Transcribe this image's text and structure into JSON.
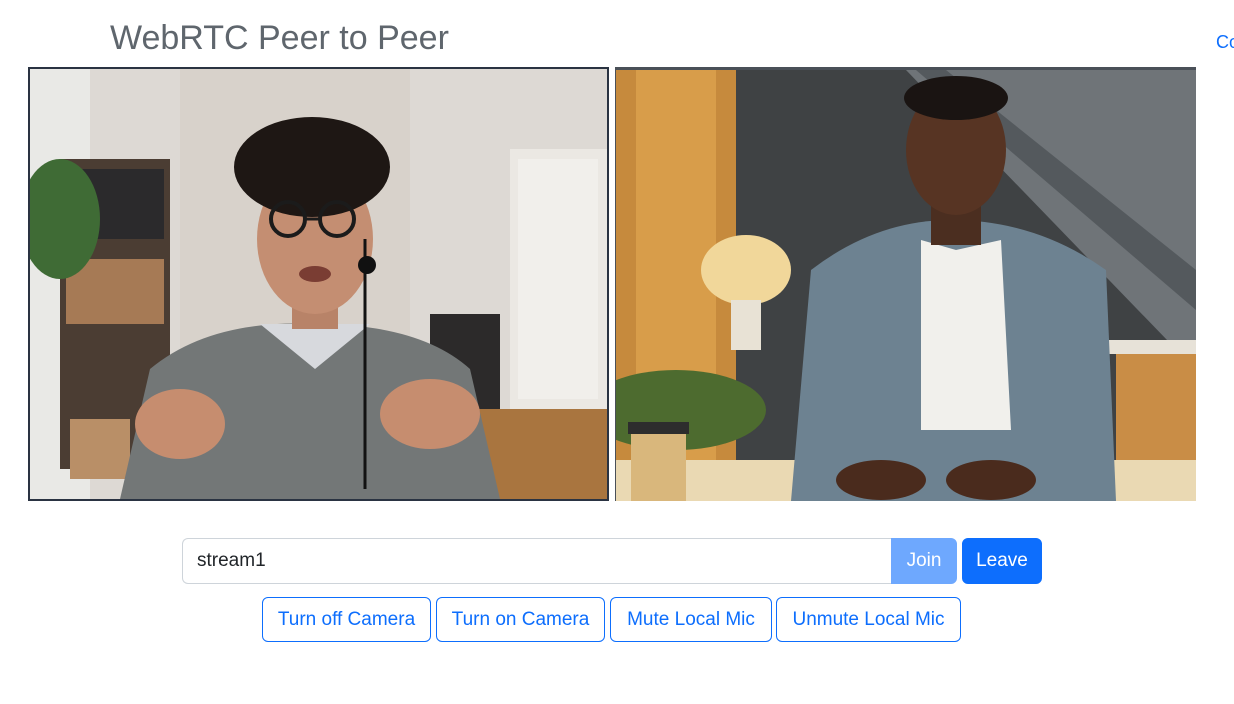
{
  "header": {
    "title": "WebRTC Peer to Peer",
    "corner_link": "Co"
  },
  "videos": {
    "local": {
      "label": "local-video"
    },
    "remote": {
      "label": "remote-video"
    }
  },
  "room": {
    "value": "stream1",
    "placeholder": ""
  },
  "actions": {
    "join_label": "Join",
    "leave_label": "Leave"
  },
  "media_controls": {
    "turn_off_camera": "Turn off Camera",
    "turn_on_camera": "Turn on Camera",
    "mute_local_mic": "Mute Local Mic",
    "unmute_local_mic": "Unmute Local Mic"
  },
  "colors": {
    "primary": "#0d6efd",
    "primary_disabled": "#6ea8fe",
    "title_gray": "#5f666d"
  }
}
